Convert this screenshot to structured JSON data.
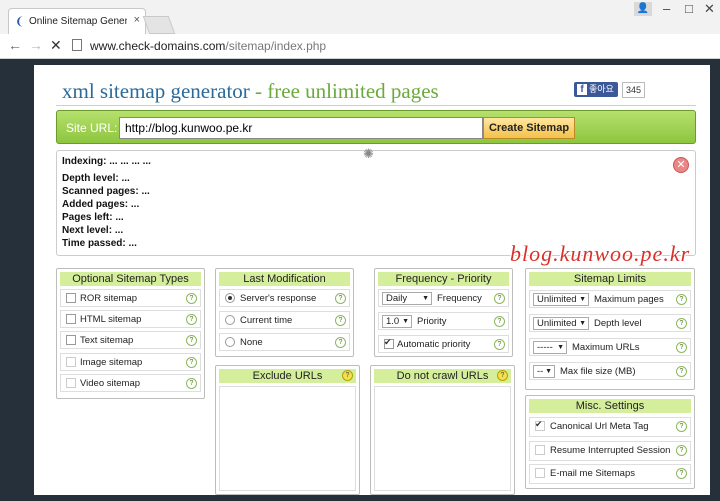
{
  "browser": {
    "tab_title": "Online Sitemap Generato",
    "tab_close": "×",
    "url_host": "www.check-domains.com",
    "url_path": "/sitemap/index.php"
  },
  "header": {
    "title_main": "xml sitemap generator",
    "title_sep": " - ",
    "title_free": "free unlimited pages",
    "fb_like": "좋아요",
    "fb_count": "345"
  },
  "urlbar": {
    "label": "Site URL:",
    "value": "http://blog.kunwoo.pe.kr",
    "create_button": "Create Sitemap"
  },
  "status": {
    "close_symbol": "✕",
    "lines": [
      {
        "label": "Indexing:",
        "value": "... ... ... ..."
      },
      {
        "label": "Depth level:",
        "value": "..."
      },
      {
        "label": "Scanned pages:",
        "value": "..."
      },
      {
        "label": "Added pages:",
        "value": "..."
      },
      {
        "label": "Pages left:",
        "value": "..."
      },
      {
        "label": "Next level:",
        "value": "..."
      },
      {
        "label": "Time passed:",
        "value": "..."
      }
    ]
  },
  "watermark": "blog.kunwoo.pe.kr",
  "optional_types": {
    "title": "Optional Sitemap Types",
    "items": [
      {
        "label": "ROR sitemap",
        "checked": false
      },
      {
        "label": "HTML sitemap",
        "checked": false
      },
      {
        "label": "Text sitemap",
        "checked": false
      },
      {
        "label": "Image sitemap",
        "checked": false
      },
      {
        "label": "Video sitemap",
        "checked": false
      }
    ]
  },
  "last_modification": {
    "title": "Last Modification",
    "options": [
      {
        "label": "Server's response",
        "selected": true
      },
      {
        "label": "Current time",
        "selected": false
      },
      {
        "label": "None",
        "selected": false
      }
    ]
  },
  "frequency_priority": {
    "title": "Frequency - Priority",
    "frequency_value": "Daily",
    "frequency_label": "Frequency",
    "priority_value": "1.0",
    "priority_label": "Priority",
    "auto_priority_label": "Automatic priority",
    "auto_priority_checked": true
  },
  "sitemap_limits": {
    "title": "Sitemap Limits",
    "rows": [
      {
        "value": "Unlimited",
        "label": "Maximum pages"
      },
      {
        "value": "Unlimited",
        "label": "Depth level"
      },
      {
        "value": "-----",
        "label": "Maximum URLs"
      },
      {
        "value": "--",
        "label": "Max file size (MB)"
      }
    ]
  },
  "exclude_urls": {
    "title": "Exclude URLs"
  },
  "do_not_crawl": {
    "title": "Do not crawl URLs"
  },
  "misc": {
    "title": "Misc. Settings",
    "items": [
      {
        "label": "Canonical Url Meta Tag",
        "checked": true
      },
      {
        "label": "Resume Interrupted Session",
        "checked": false
      },
      {
        "label": "E-mail me Sitemaps",
        "checked": false
      }
    ]
  },
  "help_symbol": "?"
}
